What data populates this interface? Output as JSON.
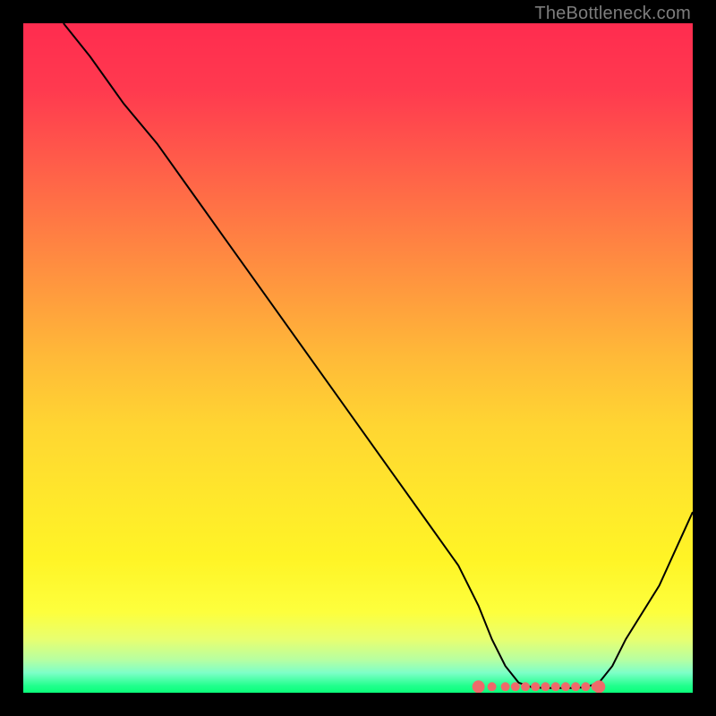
{
  "attribution": "TheBottleneck.com",
  "chart_data": {
    "type": "line",
    "title": "",
    "xlabel": "",
    "ylabel": "",
    "xlim": [
      0,
      100
    ],
    "ylim": [
      0,
      100
    ],
    "x": [
      6,
      10,
      15,
      20,
      25,
      30,
      35,
      40,
      45,
      50,
      55,
      60,
      65,
      68,
      70,
      72,
      74,
      76,
      78,
      80,
      82,
      84,
      86,
      88,
      90,
      95,
      100
    ],
    "values": [
      100,
      95,
      88,
      82,
      75,
      68,
      61,
      54,
      47,
      40,
      33,
      26,
      19,
      13,
      8,
      4,
      1.5,
      0.8,
      0.7,
      0.7,
      0.7,
      0.8,
      1.5,
      4,
      8,
      16,
      27
    ],
    "flat_region_x": [
      68,
      86
    ],
    "dot_xs": [
      68,
      70,
      72,
      73.5,
      75,
      76.5,
      78,
      79.5,
      81,
      82.5,
      84,
      85.5,
      86
    ],
    "colors": {
      "line": "#000000",
      "dots": "#ee6a6a",
      "gradient_top": "#ff2c4f",
      "gradient_bottom": "#0aff7a"
    }
  }
}
